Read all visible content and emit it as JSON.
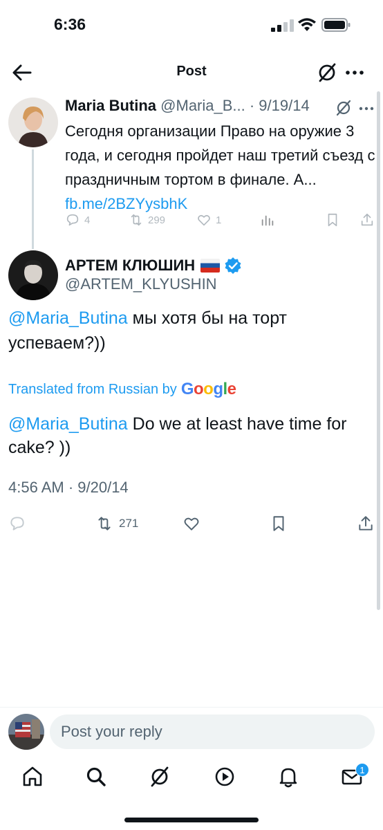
{
  "status_bar": {
    "time": "6:36"
  },
  "header": {
    "title": "Post"
  },
  "parent_tweet": {
    "name": "Maria Butina",
    "handle_date": "@Maria_B... · 9/19/14",
    "text": "Сегодня организации Право на оружие 3 года, и сегодня пройдет наш третий съезд с праздничным тортом в финале. А... ",
    "link": "fb.me/2BZYysbhK",
    "replies": "4",
    "retweets": "299",
    "likes": "1"
  },
  "main_tweet": {
    "name": "АРТЕМ КЛЮШИН",
    "handle": "@ARTEM_KLYUSHIN",
    "mention": "@Maria_Butina",
    "text": " мы хотя бы на торт успеваем?))",
    "translated_label": "Translated from Russian by",
    "translator": "Google",
    "translation_mention": "@Maria_Butina",
    "translation_text": " Do we at least have time for cake? ))",
    "timestamp": "4:56 AM · 9/20/14",
    "retweets": "271"
  },
  "reply": {
    "placeholder": "Post your reply"
  },
  "nav": {
    "messages_badge": "1"
  },
  "colors": {
    "accent": "#1d9bf0",
    "text": "#0f1419",
    "muted": "#536471"
  },
  "icons": [
    "back-arrow-icon",
    "grok-icon",
    "more-icon",
    "reply-icon",
    "retweet-icon",
    "like-icon",
    "views-icon",
    "bookmark-icon",
    "share-icon",
    "verified-icon",
    "russia-flag-icon",
    "home-icon",
    "search-icon",
    "play-icon",
    "bell-icon",
    "mail-icon"
  ]
}
